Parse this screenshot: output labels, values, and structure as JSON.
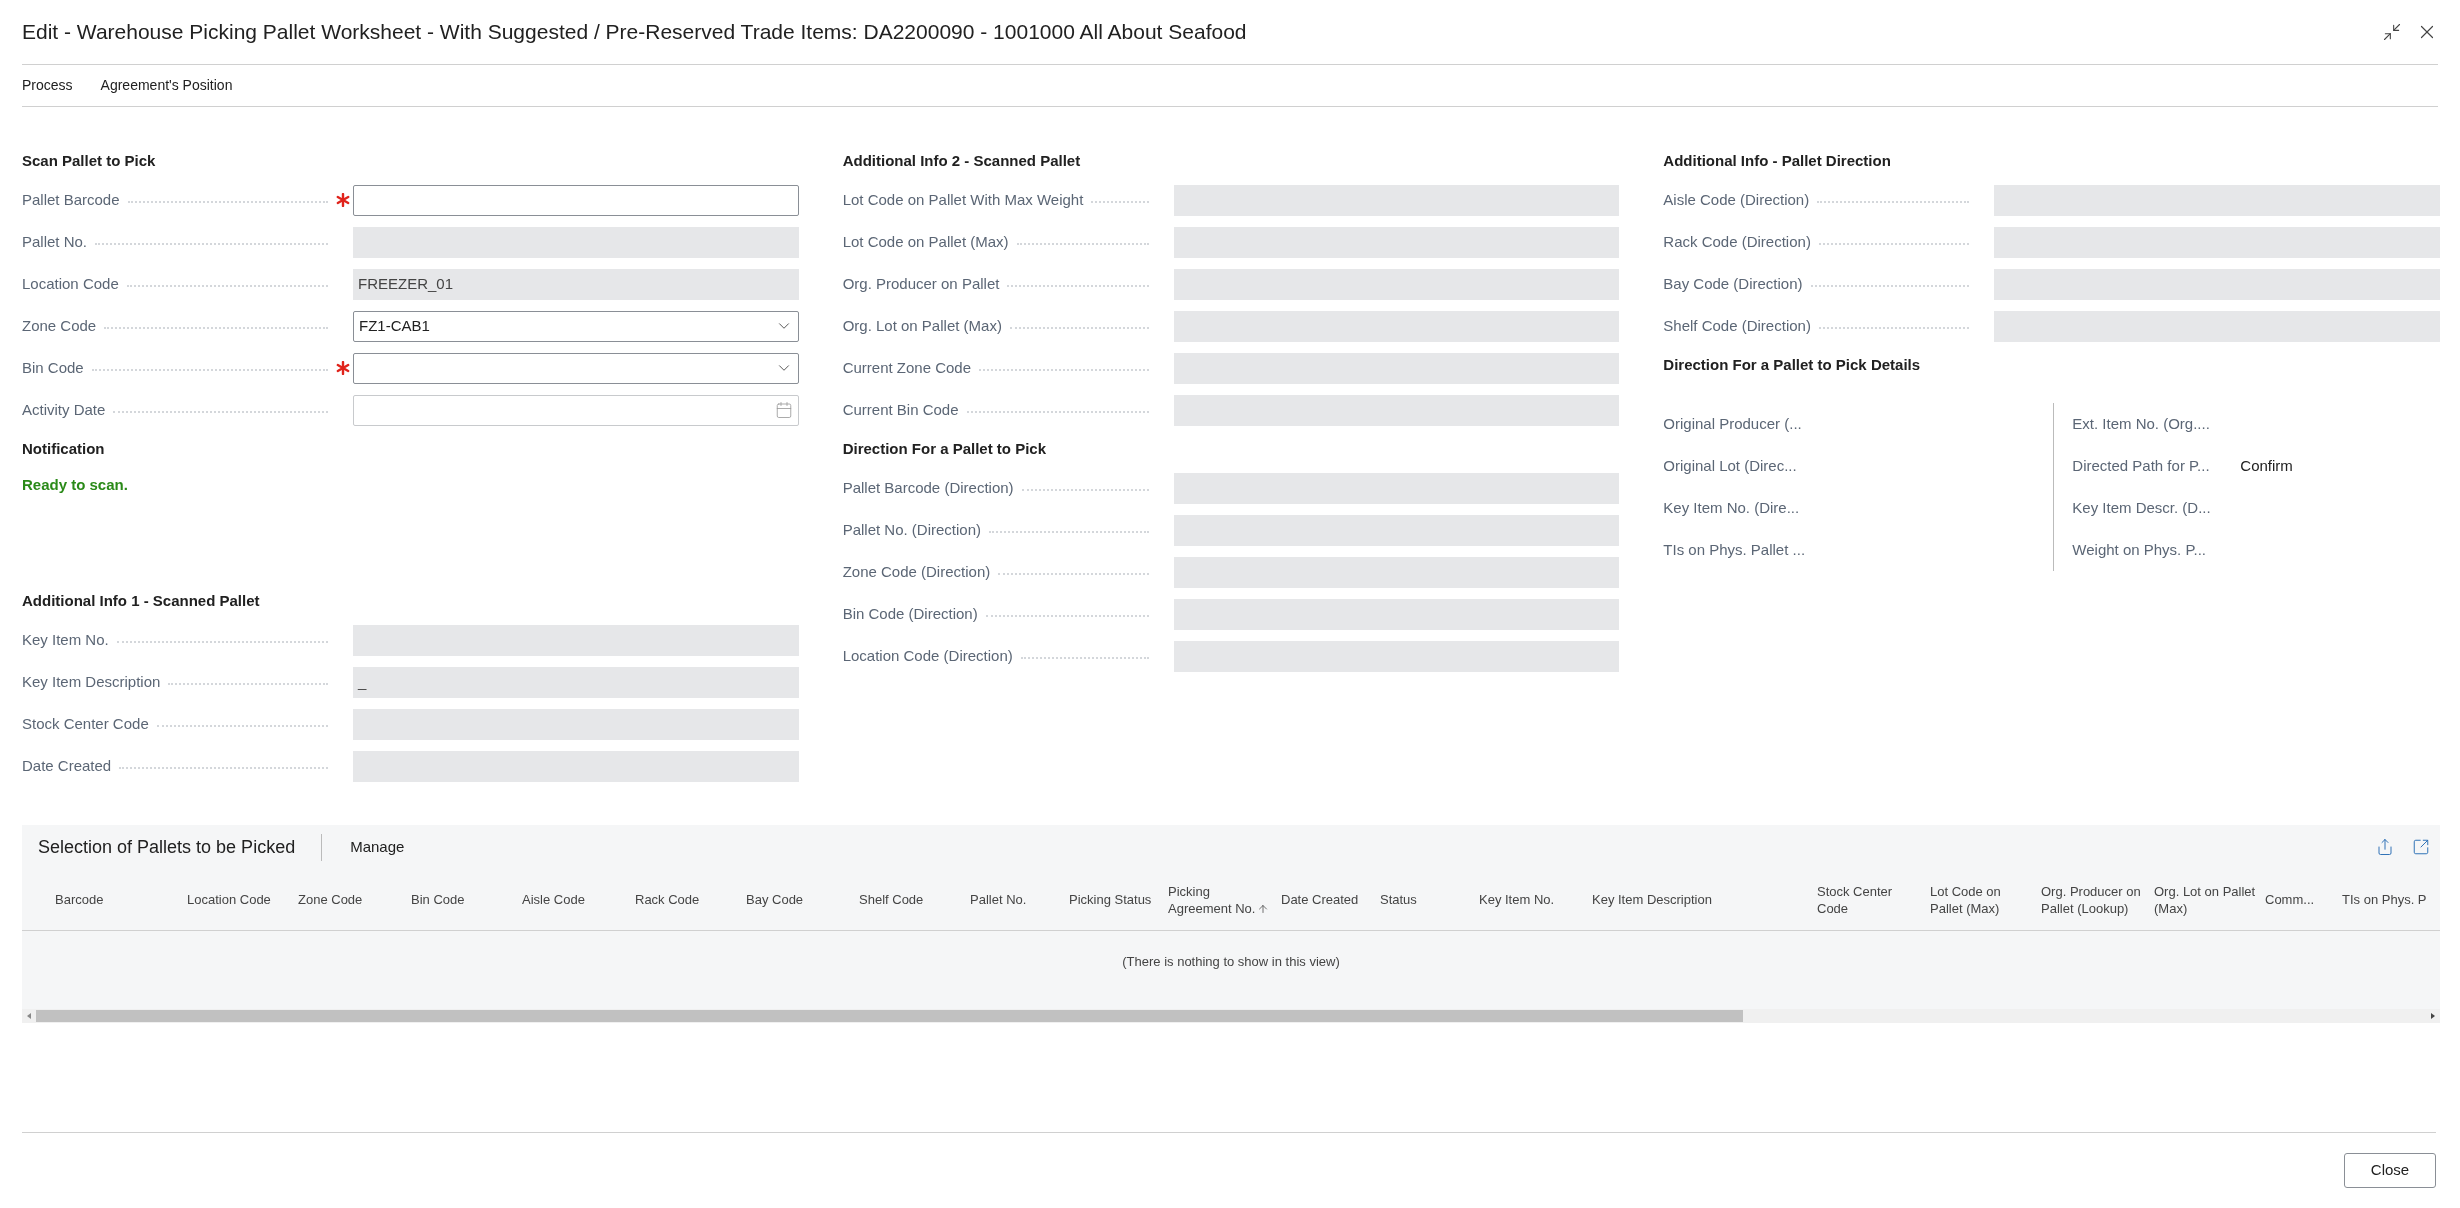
{
  "dialog": {
    "title": "Edit - Warehouse Picking Pallet Worksheet - With Suggested / Pre-Reserved Trade Items: DA2200090 - 1001000 All About Seafood"
  },
  "action_bar": {
    "items": [
      "Process",
      "Agreement's Position"
    ]
  },
  "columns": [
    {
      "sections": [
        {
          "kind": "fields",
          "title": "Scan Pallet to Pick",
          "fields": [
            {
              "label": "Pallet Barcode",
              "kind": "input",
              "required": true
            },
            {
              "label": "Pallet No.",
              "kind": "readonly",
              "required": false
            },
            {
              "label": "Location Code",
              "kind": "readonly",
              "required": false,
              "value": "FREEZER_01"
            },
            {
              "label": "Zone Code",
              "kind": "dropdown",
              "required": false,
              "value": "FZ1-CAB1"
            },
            {
              "label": "Bin Code",
              "kind": "dropdown",
              "required": true
            },
            {
              "label": "Activity Date",
              "kind": "date",
              "required": false
            }
          ]
        },
        {
          "kind": "notification",
          "title": "Notification",
          "message": "Ready to scan."
        },
        {
          "kind": "fields",
          "title": "Additional Info 1 - Scanned Pallet",
          "fields": [
            {
              "label": "Key Item No.",
              "kind": "readonly",
              "required": false
            },
            {
              "label": "Key Item Description",
              "kind": "readonly",
              "required": false,
              "value": "_"
            },
            {
              "label": "Stock Center Code",
              "kind": "readonly",
              "required": false
            },
            {
              "label": "Date Created",
              "kind": "readonly",
              "required": false
            }
          ]
        }
      ]
    },
    {
      "sections": [
        {
          "kind": "fields",
          "title": "Additional Info 2 - Scanned Pallet",
          "fields": [
            {
              "label": "Lot Code on Pallet With Max Weight",
              "kind": "readonly",
              "required": false
            },
            {
              "label": "Lot Code on Pallet (Max)",
              "kind": "readonly",
              "required": false
            },
            {
              "label": "Org. Producer on Pallet",
              "kind": "readonly",
              "required": false
            },
            {
              "label": "Org. Lot on Pallet (Max)",
              "kind": "readonly",
              "required": false
            },
            {
              "label": "Current Zone Code",
              "kind": "readonly",
              "required": false
            },
            {
              "label": "Current Bin Code",
              "kind": "readonly",
              "required": false
            }
          ]
        },
        {
          "kind": "fields",
          "title": "Direction For a Pallet to Pick",
          "fields": [
            {
              "label": "Pallet Barcode (Direction)",
              "kind": "readonly",
              "required": false
            },
            {
              "label": "Pallet No. (Direction)",
              "kind": "readonly",
              "required": false
            },
            {
              "label": "Zone Code (Direction)",
              "kind": "readonly",
              "required": false
            },
            {
              "label": "Bin Code (Direction)",
              "kind": "readonly",
              "required": false
            },
            {
              "label": "Location Code (Direction)",
              "kind": "readonly",
              "required": false
            }
          ]
        }
      ]
    },
    {
      "sections": [
        {
          "kind": "fields",
          "title": "Additional Info - Pallet Direction",
          "fields": [
            {
              "label": "Aisle Code (Direction)",
              "kind": "readonly",
              "required": false
            },
            {
              "label": "Rack Code (Direction)",
              "kind": "readonly",
              "required": false
            },
            {
              "label": "Bay Code (Direction)",
              "kind": "readonly",
              "required": false
            },
            {
              "label": "Shelf Code (Direction)",
              "kind": "readonly",
              "required": false
            }
          ]
        },
        {
          "kind": "details",
          "title": "Direction For a Pallet to Pick Details",
          "groups": [
            [
              {
                "label": "Original Producer (..."
              },
              {
                "label": "Original Lot (Direc..."
              },
              {
                "label": "Key Item No. (Dire..."
              },
              {
                "label": "TIs on Phys. Pallet ..."
              }
            ],
            [
              {
                "label": "Ext. Item No. (Org...."
              },
              {
                "label": "Directed Path for P...",
                "value": "Confirm"
              },
              {
                "label": "Key Item Descr. (D..."
              },
              {
                "label": "Weight on Phys. P..."
              }
            ]
          ]
        }
      ]
    }
  ],
  "table": {
    "title": "Selection of Pallets to be Picked",
    "actions": [
      "Manage"
    ],
    "columns": [
      {
        "label": "Barcode",
        "sorted": false
      },
      {
        "label": "Location Code",
        "sorted": false
      },
      {
        "label": "Zone Code",
        "sorted": false
      },
      {
        "label": "Bin Code",
        "sorted": false
      },
      {
        "label": "Aisle Code",
        "sorted": false
      },
      {
        "label": "Rack Code",
        "sorted": false
      },
      {
        "label": "Bay Code",
        "sorted": false
      },
      {
        "label": "Shelf Code",
        "sorted": false
      },
      {
        "label": "Pallet No.",
        "sorted": false
      },
      {
        "label": "Picking Status",
        "sorted": false
      },
      {
        "label": "Picking Agreement No.",
        "sorted": true
      },
      {
        "label": "Date Created",
        "sorted": false
      },
      {
        "label": "Status",
        "sorted": false
      },
      {
        "label": "Key Item No.",
        "sorted": false
      },
      {
        "label": "Key Item Description",
        "sorted": false
      },
      {
        "label": "Stock Center Code",
        "sorted": false
      },
      {
        "label": "Lot Code on Pallet (Max)",
        "sorted": false
      },
      {
        "label": "Org. Producer on Pallet (Lookup)",
        "sorted": false
      },
      {
        "label": "Org. Lot on Pallet (Max)",
        "sorted": false
      },
      {
        "label": "Comm...",
        "sorted": false
      },
      {
        "label": "TIs on Phys. P",
        "sorted": false
      }
    ],
    "empty_message": "(There is nothing to show in this view)"
  },
  "footer": {
    "buttons": [
      "Close"
    ]
  }
}
